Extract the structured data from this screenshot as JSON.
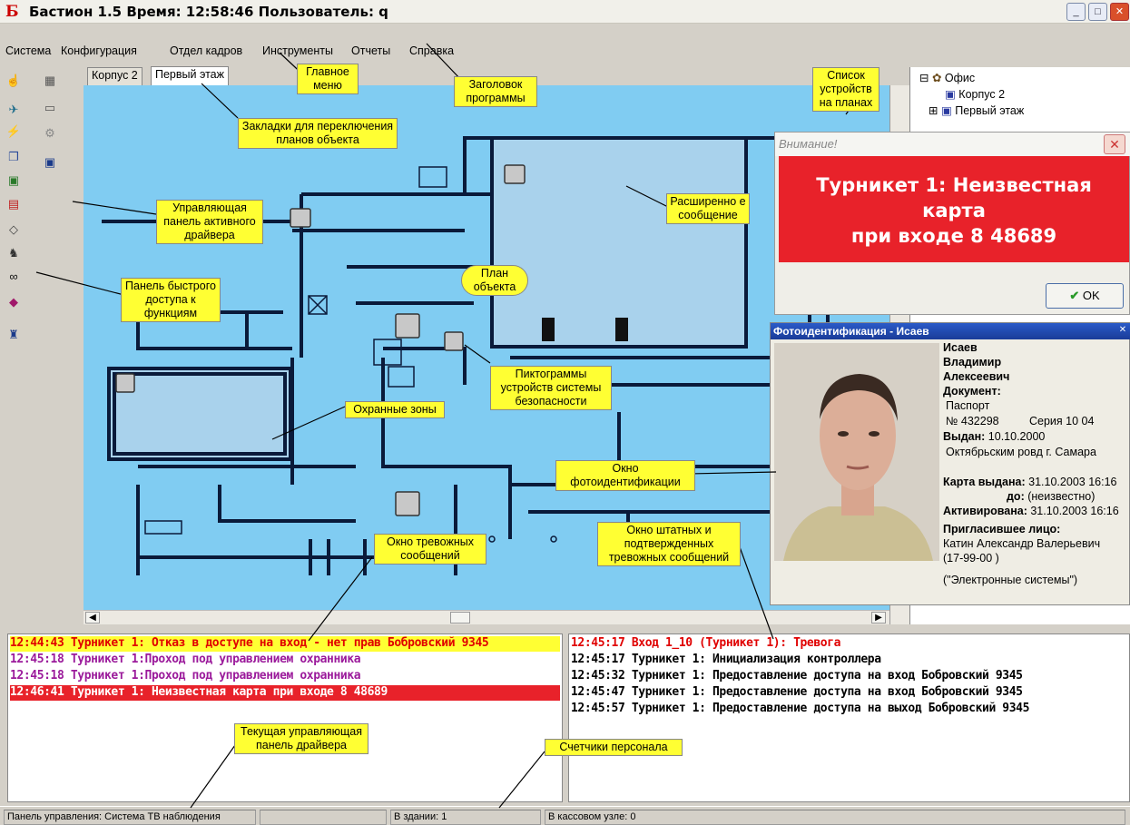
{
  "window": {
    "title": "Бастион 1.5 Время: 12:58:46 Пользователь: q",
    "minimize": "_",
    "restore": "□",
    "close": "✕"
  },
  "menu": [
    "Система",
    "Конфигурация",
    "Отдел кадров",
    "Инструменты",
    "Отчеты",
    "Справка"
  ],
  "plan_tabs": [
    "Корпус 2",
    "Первый этаж"
  ],
  "tree": {
    "root": "Офис",
    "items": [
      "Корпус 2",
      "Первый этаж"
    ]
  },
  "alert_dialog": {
    "caption": "Внимание!",
    "message_line1": "Турникет 1: Неизвестная карта",
    "message_line2": "при входе 8 48689",
    "ok_label": "OK"
  },
  "photo_window": {
    "caption": "Фотоидентификация - Исаев",
    "surname": "Исаев",
    "name": "Владимир",
    "patronymic": "Алексеевич",
    "doc_label": "Документ:",
    "doc_type": "Паспорт",
    "doc_number": "№ 432298",
    "doc_series": "Серия 10 04",
    "issued_label": "Выдан:",
    "issued_date": "10.10.2000",
    "issued_by": "Октябрьским ровд г. Самара",
    "card_label": "Карта выдана:",
    "card_date": "31.10.2003 16:16",
    "until_label": "до:",
    "until_value": "(неизвестно)",
    "activated_label": "Активирована:",
    "activated_date": "31.10.2003 16:16",
    "inviter_label": "Пригласившее лицо:",
    "inviter_name": "Катин Александр Валерьевич",
    "inviter_phone": "(17-99-00 )",
    "inviter_org": "(\"Электронные системы\")"
  },
  "alarm_log": [
    {
      "text": "12:44:43 Турникет 1: Отказ в доступе на вход - нет прав  Бобровский 9345",
      "color": "#e00000",
      "bg": "#ffff33"
    },
    {
      "text": "12:45:18 Турникет 1:Проход под управлением охранника",
      "color": "#9b1a9b",
      "bg": "#ffffff"
    },
    {
      "text": "12:45:18 Турникет 1:Проход под управлением охранника",
      "color": "#9b1a9b",
      "bg": "#ffffff"
    },
    {
      "text": "12:46:41 Турникет 1: Неизвестная карта при входе 8 48689",
      "color": "#ffffff",
      "bg": "#e8222a"
    }
  ],
  "event_log": [
    {
      "text": "12:45:17 Вход 1_10 (Турникет 1): Тревога",
      "color": "#e00000"
    },
    {
      "text": "12:45:17 Турникет 1: Инициализация контроллера",
      "color": "#000000"
    },
    {
      "text": "12:45:32 Турникет 1: Предоставление доступа на вход Бобровский 9345",
      "color": "#000000"
    },
    {
      "text": "12:45:47 Турникет 1: Предоставление доступа на вход Бобровский 9345",
      "color": "#000000"
    },
    {
      "text": "12:45:57 Турникет 1: Предоставление доступа на выход Бобровский 9345",
      "color": "#000000"
    }
  ],
  "status": {
    "panel": "Панель управления: Система ТВ наблюдения",
    "in_building": "В здании: 1",
    "in_cash": "В кассовом узле: 0"
  },
  "callouts": {
    "main_menu": "Главное меню",
    "program_title": "Заголовок программы",
    "device_list": "Список устройств на планах",
    "plan_tabs": "Закладки для переключения планов объекта",
    "driver_panel": "Управляющая панель активного драйвера",
    "extended_msg": "Расширенно е сообщение",
    "quick_panel": "Панель быстрого доступа к функциям",
    "object_plan": "План объекта",
    "device_icons": "Пиктограммы устройств системы безопасности",
    "guard_zones": "Охранные зоны",
    "photo_window": "Окно фотоидентификации",
    "regular_alarms": "Окно штатных и подтвержденных тревожных сообщений",
    "alarm_window": "Окно тревожных сообщений",
    "current_panel": "Текущая управляющая панель драйвера",
    "staff_counters": "Счетчики персонала"
  },
  "colors": {
    "map_bg": "#80ccf2",
    "callout": "#ffff33",
    "alarm_red": "#e8222a"
  },
  "icons": [
    "fingerprint-icon",
    "camera-icon",
    "lightning-icon",
    "documents-icon",
    "person-card-icon",
    "id-card-icon",
    "tag-icon",
    "people-icon",
    "binoculars-icon",
    "book-icon",
    "building-icon",
    "monitor-icon",
    "gear-icon"
  ]
}
